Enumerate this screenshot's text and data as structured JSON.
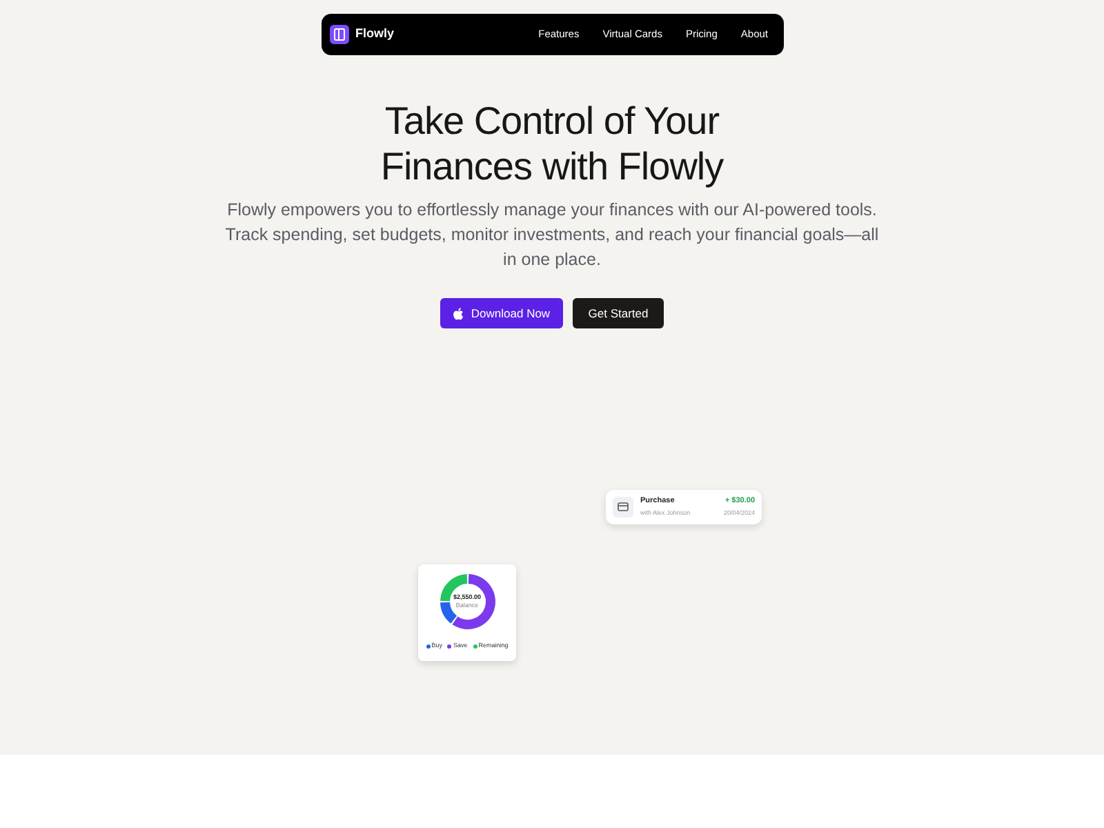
{
  "nav": {
    "brand": "Flowly",
    "links": [
      "Features",
      "Virtual Cards",
      "Pricing",
      "About"
    ]
  },
  "hero": {
    "title_lines": [
      "Take Control of Your",
      "Finances with Flowly"
    ],
    "text": "Flowly empowers you to effortlessly manage your finances with our AI-powered tools. Track spending, set budgets, monitor investments, and reach your financial goals—all in one place.",
    "buttons": [
      {
        "kind": "primary",
        "label": "Download Now"
      },
      {
        "kind": "dark",
        "label": "Get Started"
      }
    ]
  },
  "transaction_card": {
    "title": "Purchase",
    "subtitle": "with Alex Johnson",
    "amount": "+ $30.00",
    "date": "20/04/2024"
  },
  "balance_card": {
    "amount": "$2,550.00",
    "caption": "Balance",
    "legend": [
      {
        "label": "Buy",
        "color": "#2563eb"
      },
      {
        "label": "Save",
        "color": "#7c3aed"
      },
      {
        "label": "Remaining",
        "color": "#22c55e"
      }
    ]
  }
}
